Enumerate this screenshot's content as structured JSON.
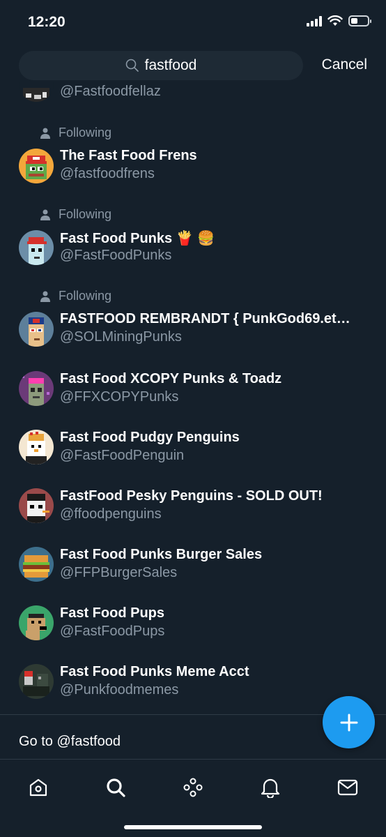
{
  "status_bar": {
    "time": "12:20",
    "battery_level": 0.3
  },
  "search": {
    "query": "fastfood",
    "cancel_label": "Cancel"
  },
  "partial_result": {
    "handle": "@Fastfoodfellaz"
  },
  "results": [
    {
      "following": "Following",
      "name": "The Fast Food Frens",
      "handle": "@fastfoodfrens",
      "avatar_color": "#f3a73b"
    },
    {
      "following": "Following",
      "name": "Fast Food Punks 🍟 🍔",
      "handle": "@FastFoodPunks",
      "avatar_color": "#6c8ea8"
    },
    {
      "following": "Following",
      "name": "FASTFOOD REMBRANDT { PunkGod69.et…",
      "handle": "@SOLMiningPunks",
      "avatar_color": "#5d7f9a"
    },
    {
      "name": "Fast Food XCOPY Punks & Toadz",
      "handle": "@FFXCOPYPunks",
      "avatar_color": "#6b3a78"
    },
    {
      "name": "Fast Food Pudgy Penguins",
      "handle": "@FastFoodPenguin",
      "avatar_color": "#f4e7d2"
    },
    {
      "name": "FastFood Pesky Penguins - SOLD OUT!",
      "handle": "@ffoodpenguins",
      "avatar_color": "#9a4a4a"
    },
    {
      "name": "Fast Food Punks Burger Sales",
      "handle": "@FFPBurgerSales",
      "avatar_color": "#3d6f8c"
    },
    {
      "name": "Fast Food Pups",
      "handle": "@FastFoodPups",
      "avatar_color": "#3aa56a"
    },
    {
      "name": "Fast Food Punks Meme Acct",
      "handle": "@Punkfoodmemes",
      "avatar_color": "#2e3a33"
    }
  ],
  "goto": {
    "label": "Go to @fastfood"
  },
  "colors": {
    "background": "#15202b",
    "accent": "#1d9bf0",
    "secondary_text": "#8b98a5"
  },
  "tabs": [
    "home-icon",
    "search-icon",
    "spaces-icon",
    "notifications-icon",
    "messages-icon"
  ]
}
